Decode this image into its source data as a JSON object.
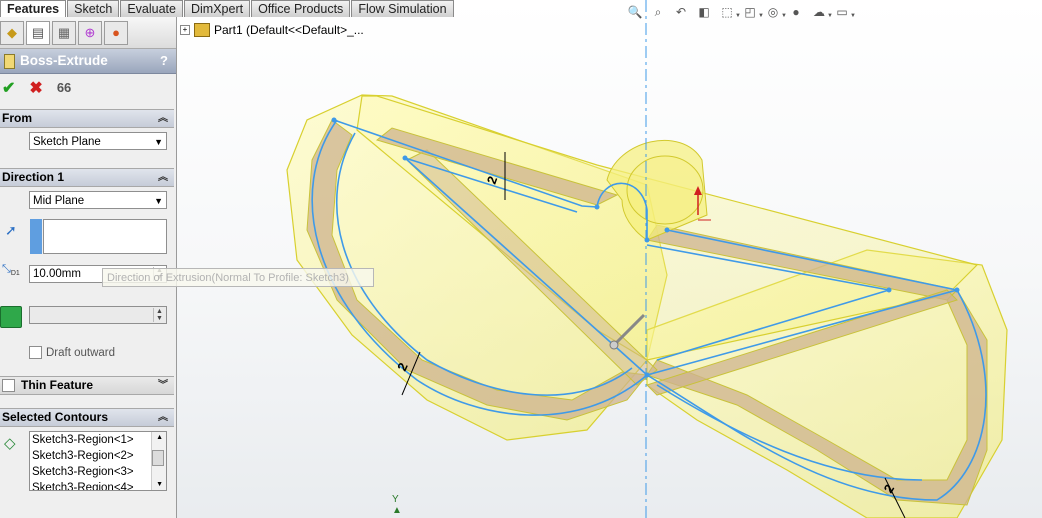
{
  "command_tabs": [
    "Features",
    "Sketch",
    "Evaluate",
    "DimXpert",
    "Office Products",
    "Flow Simulation"
  ],
  "panel": {
    "title": "Boss-Extrude",
    "help": "?",
    "from": {
      "label": "From",
      "value": "Sketch Plane"
    },
    "direction1": {
      "label": "Direction 1",
      "end_condition": "Mid Plane",
      "depth": "10.00mm",
      "draft_outward": "Draft outward"
    },
    "thin_feature": {
      "label": "Thin Feature"
    },
    "selected_contours": {
      "label": "Selected Contours",
      "items": [
        "Sketch3-Region<1>",
        "Sketch3-Region<2>",
        "Sketch3-Region<3>",
        "Sketch3-Region<4>"
      ]
    }
  },
  "tooltip": "Direction of Extrusion(Normal To Profile: Sketch3)",
  "tree": {
    "root": "Part1  (Default<<Default>_..."
  },
  "triad": {
    "axis": "Y"
  },
  "dimensions": [
    "2",
    "2",
    "2"
  ],
  "colors": {
    "preview_fill": "#f7f46a",
    "preview_edge": "#d9d22a",
    "sketch_line": "#3f9ae8",
    "panel_bg": "#efefef",
    "title_bar": "#9aa6bc"
  },
  "icons": {
    "ok": "check-icon",
    "cancel": "x-icon",
    "preview": "glasses-icon",
    "hud": [
      "zoom-to-fit-icon",
      "zoom-area-icon",
      "previous-view-icon",
      "section-view-icon",
      "view-orientation-icon",
      "display-style-icon",
      "hide-show-icon",
      "edit-appearance-icon",
      "apply-scene-icon",
      "view-settings-icon"
    ]
  }
}
